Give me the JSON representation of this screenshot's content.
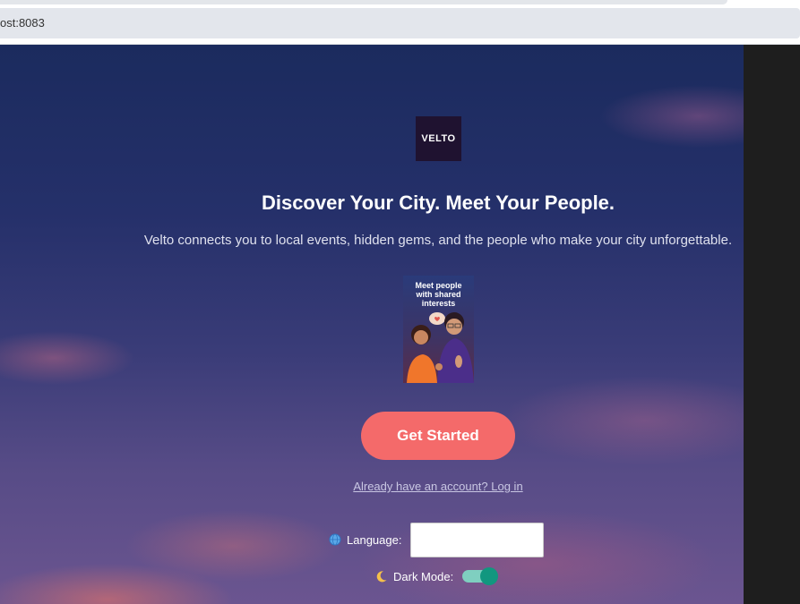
{
  "browser": {
    "address": "ost:8083"
  },
  "brand": {
    "logo_text": "VELTO"
  },
  "hero": {
    "headline": "Discover Your City. Meet Your People.",
    "subtitle": "Velto connects you to local events, hidden gems, and the people who make your city unforgettable.",
    "illustration_text": "Meet people with shared interests"
  },
  "actions": {
    "get_started": "Get Started",
    "login_link": "Already have an account? Log in"
  },
  "settings": {
    "language_icon": "globe-icon",
    "language_label": "Language:",
    "language_value": "",
    "dark_mode_icon": "moon-icon",
    "dark_mode_label": "Dark Mode:",
    "dark_mode_on": true
  },
  "colors": {
    "accent": "#f46a6a",
    "toggle_on": "#11977f",
    "logo_bg": "#1f1230"
  }
}
